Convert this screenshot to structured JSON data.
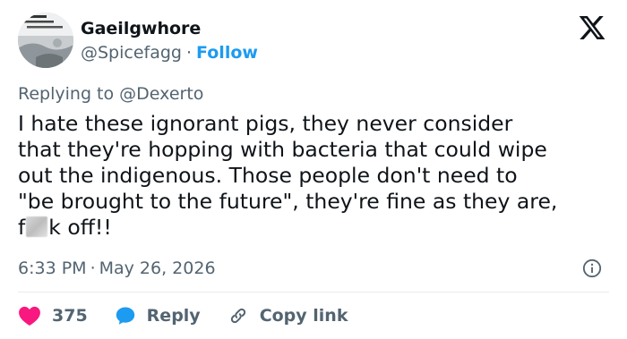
{
  "header": {
    "display_name": "Gaeilgwhore",
    "handle": "@Spicefagg",
    "separator": "·",
    "follow_label": "Follow",
    "logo_icon": "x-logo-icon"
  },
  "reply_context": {
    "prefix": "Replying to",
    "mention": "@Dexerto"
  },
  "tweet": {
    "lines": [
      "I hate these ignorant pigs, they never consider",
      "that they're hopping with bacteria that could wipe",
      "out the indigenous. Those people don't need to",
      "\"be brought to the future\", they're fine as they are,"
    ],
    "last_line_start": "f",
    "last_line_end": "k off!!"
  },
  "meta": {
    "time": "6:33 PM",
    "separator": "·",
    "date": "May 26, 2026",
    "info_icon": "info-icon"
  },
  "actions": {
    "like_count": "375",
    "reply_label": "Reply",
    "copy_label": "Copy link"
  },
  "colors": {
    "text": "#0f1419",
    "secondary": "#536471",
    "accent": "#1d9bf0",
    "like": "#f91880",
    "divider": "#e7ecf0"
  }
}
